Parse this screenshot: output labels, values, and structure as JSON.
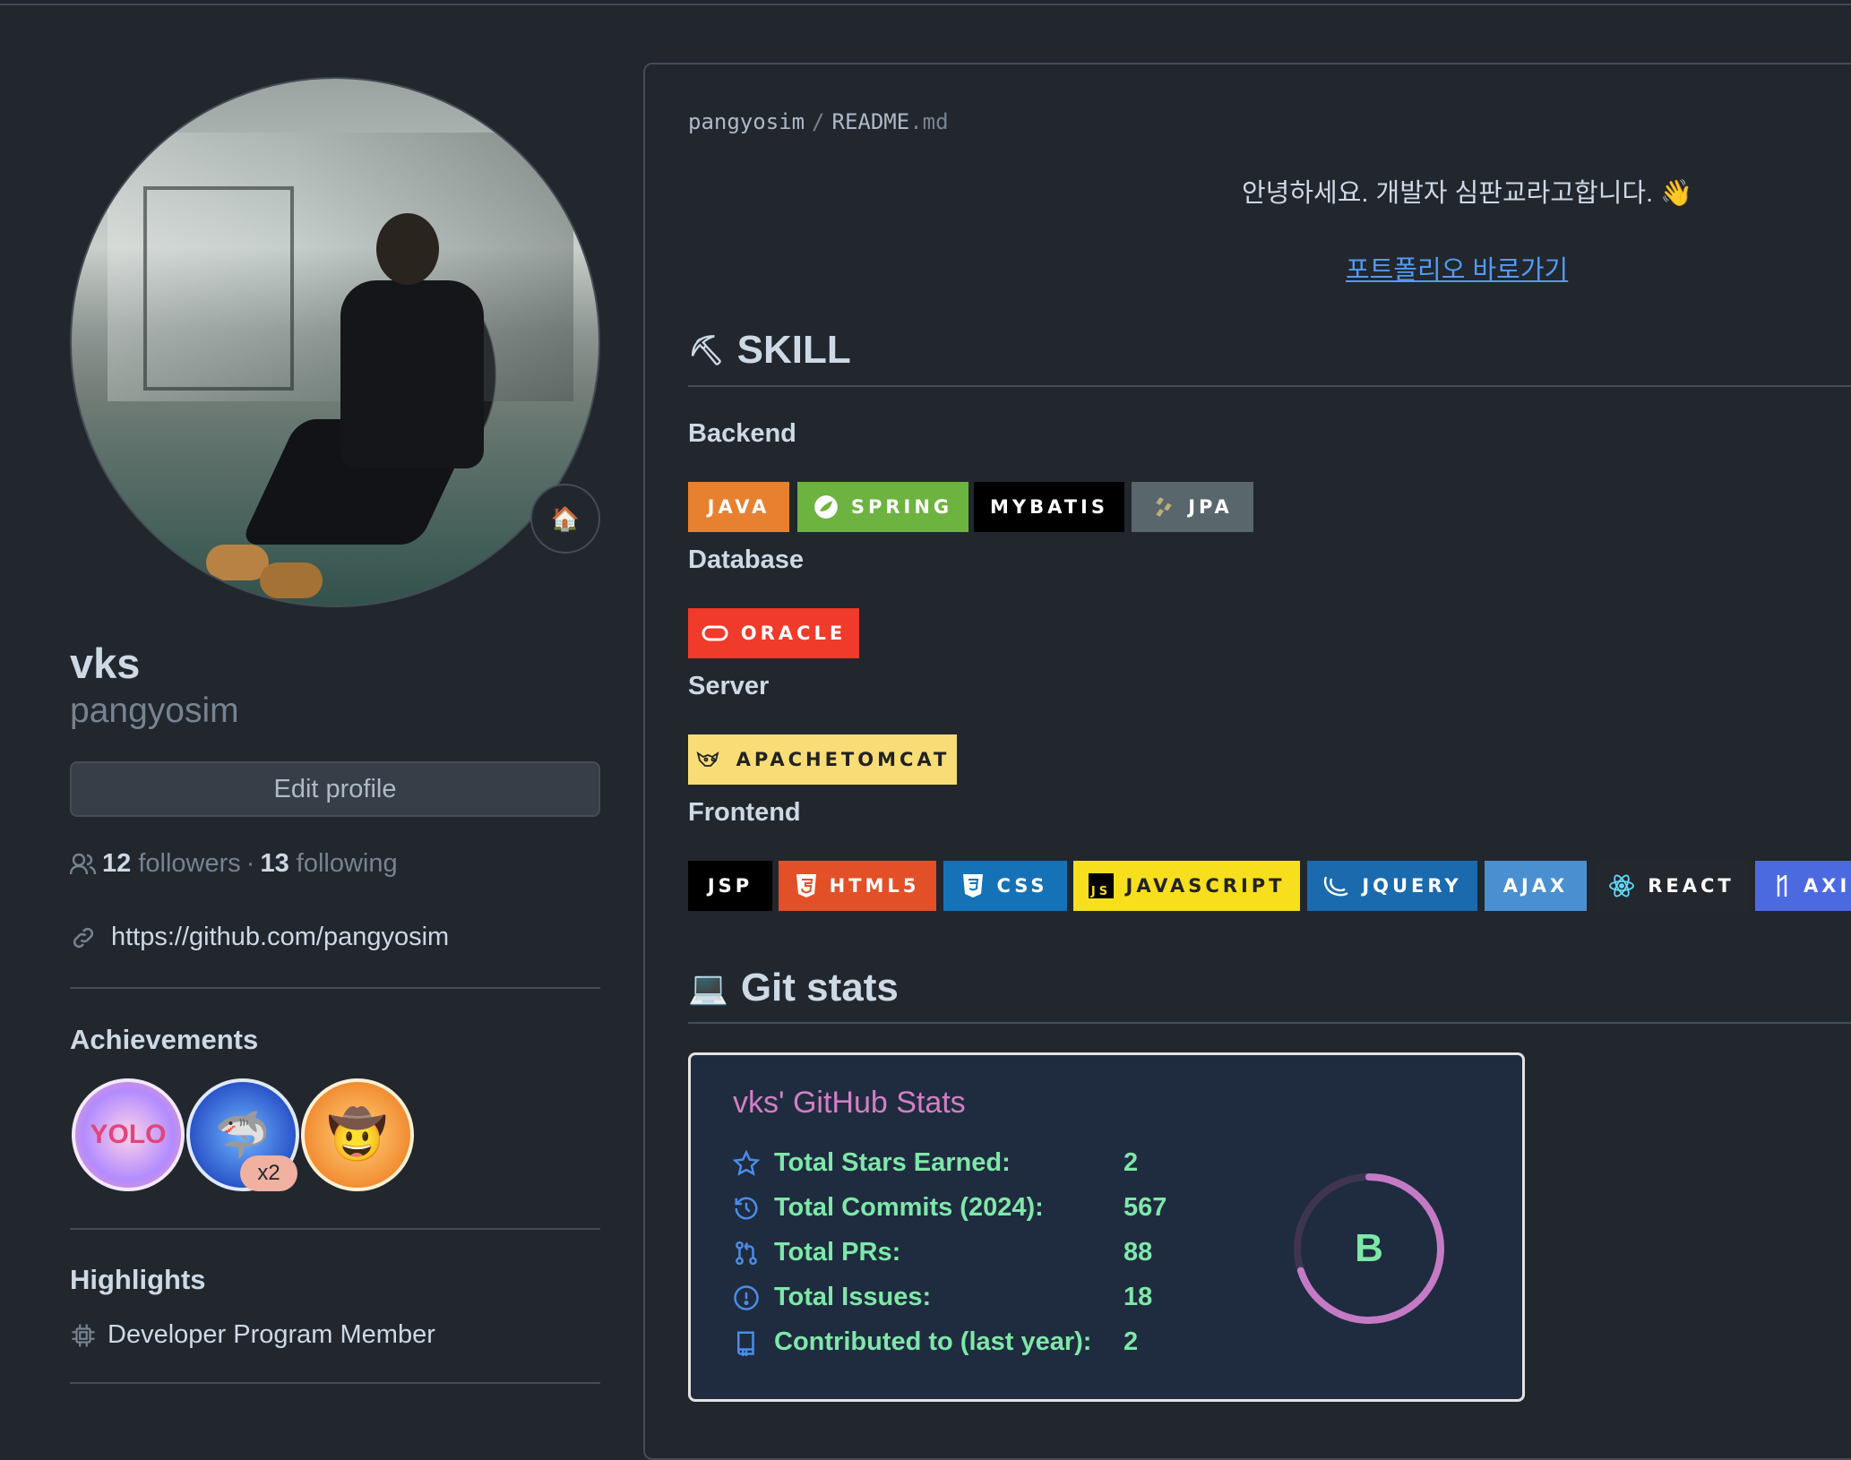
{
  "profile": {
    "name": "vks",
    "login": "pangyosim",
    "status_emoji": "🏠",
    "edit_label": "Edit profile",
    "followers_count": "12",
    "followers_label": "followers",
    "separator": "·",
    "following_count": "13",
    "following_label": "following",
    "website": "https://github.com/pangyosim"
  },
  "achievements": {
    "heading": "Achievements",
    "items": [
      {
        "name": "yolo",
        "text": "YOLO"
      },
      {
        "name": "pull-shark",
        "text": "🦈",
        "count": "x2"
      },
      {
        "name": "quickdraw",
        "text": "🤠"
      }
    ]
  },
  "highlights": {
    "heading": "Highlights",
    "items": [
      "Developer Program Member"
    ]
  },
  "readme": {
    "owner": "pangyosim",
    "sep": "/",
    "file": "README",
    "ext": ".md",
    "greeting": "안녕하세요. 개발자 심판교라고합니다. 👋",
    "portfolio_link": "포트폴리오 바로가기",
    "skill_heading": "SKILL",
    "skill_emoji": "⛏",
    "backend_heading": "Backend",
    "database_heading": "Database",
    "server_heading": "Server",
    "frontend_heading": "Frontend",
    "gitstats_heading": "Git stats",
    "gitstats_emoji": "💻",
    "badges": {
      "java": "JAVA",
      "spring": "SPRING",
      "mybatis": "MYBATIS",
      "jpa": "JPA",
      "oracle": "ORACLE",
      "tomcat": "APACHETOMCAT",
      "jsp": "JSP",
      "html5": "HTML5",
      "css": "CSS",
      "javascript": "JAVASCRIPT",
      "jquery": "JQUERY",
      "ajax": "AJAX",
      "react": "REACT",
      "axios": "AXI"
    },
    "colors": {
      "java": "#e76f00",
      "spring": "#6db33f",
      "mybatis": "#000000",
      "jpa": "#59666c",
      "oracle": "#f80000",
      "tomcat": "#f8dc75",
      "jsp": "#000000",
      "html5": "#e34f26",
      "css": "#1572b6",
      "javascript": "#f7df1e",
      "jquery": "#0769ad",
      "ajax": "#4a90d9",
      "react": "#23272e",
      "axios": "#5a29e4"
    }
  },
  "stats": {
    "title": "vks' GitHub Stats",
    "rows": [
      {
        "label": "Total Stars Earned:",
        "value": "2"
      },
      {
        "label": "Total Commits (2024):",
        "value": "567"
      },
      {
        "label": "Total PRs:",
        "value": "88"
      },
      {
        "label": "Total Issues:",
        "value": "18"
      },
      {
        "label": "Contributed to (last year):",
        "value": "2"
      }
    ],
    "grade": "B",
    "grade_progress": 0.7
  }
}
